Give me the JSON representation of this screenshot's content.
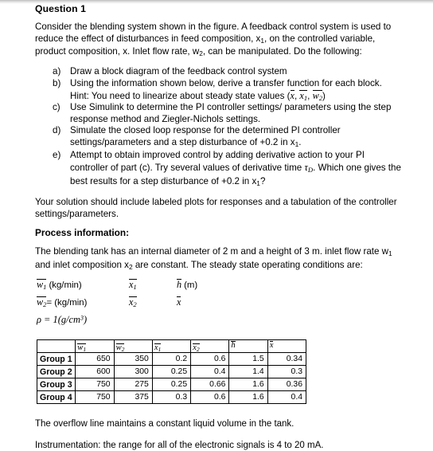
{
  "document": {
    "title": "Question 1",
    "intro": {
      "line1": "Consider the blending system shown in the figure. A feedback control system is used to",
      "line2_a": "reduce the effect of disturbances in feed composition, x",
      "line2_sub": "1",
      "line2_b": ", on the controlled variable,",
      "line3_a": "product composition, x. Inlet flow rate, w",
      "line3_sub": "2",
      "line3_b": ", can be manipulated. Do the following:"
    },
    "items": [
      {
        "marker": "a)",
        "text": "Draw a block diagram of the feedback control system"
      },
      {
        "marker": "b)",
        "text": "Using the information shown below, derive a transfer function for each block.",
        "hint_prefix": "Hint: You need to linearize about steady state values (",
        "hint_v1": "x",
        "hint_v2": "x",
        "hint_v2_sub": "1",
        "hint_v3": "w",
        "hint_v3_sub": "2",
        "hint_suffix": ")"
      },
      {
        "marker": "c)",
        "text": "Use Simulink to determine the PI controller settings/ parameters using the step response method and Ziegler-Nichols settings."
      },
      {
        "marker": "d)",
        "text_a": "Simulate the closed loop response for the determined PI controller settings/parameters and a step disturbance of +0.2 in x",
        "text_sub": "1",
        "text_b": "."
      },
      {
        "marker": "e)",
        "text_a": "Attempt to obtain improved control by adding derivative action to your PI controller of part (c). Try several values of derivative time ",
        "tau": "τ",
        "tau_sub": "D",
        "text_b": ". Which one gives the best results for a step disturbance of +0.2 in x",
        "text_sub2": "1",
        "text_c": "?"
      }
    ],
    "solution_note": "Your solution should include labeled plots for responses and a tabulation of the controller settings/parameters.",
    "process_heading": "Process information:",
    "process_text_a": "The blending tank has an internal diameter of 2 m and a height of 3 m. inlet flow rate w",
    "process_text_sub": "1",
    "process_text_b": " and inlet composition x",
    "process_text_sub2": "2",
    "process_text_c": " are constant. The steady state operating conditions are:",
    "variables": {
      "row1": {
        "v1_sym": "w",
        "v1_sub": "1",
        "v1_unit": "(kg/min)",
        "v2_sym": "x",
        "v2_sub": "1",
        "v3_sym": "h",
        "v3_unit": "(m)"
      },
      "row2": {
        "v1_sym": "w",
        "v1_sub": "2",
        "v1_unit": "= (kg/min)",
        "v2_sym": "x",
        "v2_sub": "2",
        "v3_sym": "x",
        "v3_unit": ""
      },
      "row3": {
        "rho": "ρ",
        "eq": " = 1(",
        "units": "g/cm",
        "sup": "3",
        "close": ")"
      }
    },
    "table": {
      "headers": [
        {
          "sym": "",
          "sub": ""
        },
        {
          "sym": "w",
          "sub": "1"
        },
        {
          "sym": "w",
          "sub": "2"
        },
        {
          "sym": "x",
          "sub": "1"
        },
        {
          "sym": "x",
          "sub": "2"
        },
        {
          "sym": "h",
          "sub": ""
        },
        {
          "sym": "x",
          "sub": ""
        }
      ],
      "rows": [
        {
          "label": "Group 1",
          "values": [
            "650",
            "350",
            "0.2",
            "0.6",
            "1.5",
            "0.34"
          ]
        },
        {
          "label": "Group 2",
          "values": [
            "600",
            "300",
            "0.25",
            "0.4",
            "1.4",
            "0.3"
          ]
        },
        {
          "label": "Group 3",
          "values": [
            "750",
            "275",
            "0.25",
            "0.66",
            "1.6",
            "0.36"
          ]
        },
        {
          "label": "Group 4",
          "values": [
            "750",
            "375",
            "0.3",
            "0.6",
            "1.6",
            "0.4"
          ]
        }
      ]
    },
    "footer": {
      "line1": "The overflow line maintains a constant liquid volume in the tank.",
      "line2": "Instrumentation: the range for all of the electronic signals is 4 to 20 mA."
    }
  }
}
